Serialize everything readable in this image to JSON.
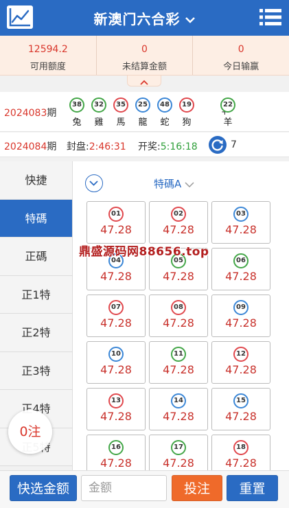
{
  "colors": {
    "primary": "#2a6bc3",
    "accent_red": "#d9362b",
    "bet_orange": "#ef6a2a",
    "balance_bg": "#fdeee4",
    "ball_red": "#e0474c",
    "ball_blue": "#3a86d6",
    "ball_green": "#43a647"
  },
  "header": {
    "title": "新澳门六合彩",
    "chart_icon": "line-chart-icon",
    "menu_icon": "menu-list-icon",
    "title_chevron": "chevron-down-icon"
  },
  "balance": [
    {
      "value": "12594.2",
      "label": "可用额度"
    },
    {
      "value": "0",
      "label": "未结算金额"
    },
    {
      "value": "0",
      "label": "今日输赢"
    }
  ],
  "last_draw": {
    "period": "2024083",
    "period_suffix": "期",
    "balls": [
      {
        "num": "38",
        "color": "green",
        "zodiac": "兔"
      },
      {
        "num": "32",
        "color": "green",
        "zodiac": "雞"
      },
      {
        "num": "35",
        "color": "red",
        "zodiac": "馬"
      },
      {
        "num": "25",
        "color": "blue",
        "zodiac": "龍"
      },
      {
        "num": "48",
        "color": "blue",
        "zodiac": "蛇"
      },
      {
        "num": "19",
        "color": "red",
        "zodiac": "狗"
      }
    ],
    "plus": "+",
    "special": {
      "num": "22",
      "color": "green",
      "zodiac": "羊"
    }
  },
  "next_draw": {
    "period": "2024084",
    "period_suffix": "期",
    "close_label": "封盘:",
    "close_time": "2:46:31",
    "open_label": "开奖:",
    "open_time": "5:16:18",
    "refresh_icon": "refresh-icon",
    "countdown": "7"
  },
  "sidebar": {
    "items": [
      {
        "label": "快捷",
        "active": false
      },
      {
        "label": "特碼",
        "active": true
      },
      {
        "label": "正碼",
        "active": false
      },
      {
        "label": "正1特",
        "active": false
      },
      {
        "label": "正2特",
        "active": false
      },
      {
        "label": "正3特",
        "active": false
      },
      {
        "label": "正4特",
        "active": false
      },
      {
        "label": "正5特",
        "active": false
      }
    ]
  },
  "main": {
    "play_type": "特碼A",
    "toggle_icon": "chevron-down-circle-icon",
    "numbers": [
      {
        "num": "01",
        "color": "red",
        "odds": "47.28"
      },
      {
        "num": "02",
        "color": "red",
        "odds": "47.28"
      },
      {
        "num": "03",
        "color": "blue",
        "odds": "47.28"
      },
      {
        "num": "04",
        "color": "blue",
        "odds": "47.28"
      },
      {
        "num": "05",
        "color": "green",
        "odds": "47.28"
      },
      {
        "num": "06",
        "color": "green",
        "odds": "47.28"
      },
      {
        "num": "07",
        "color": "red",
        "odds": "47.28"
      },
      {
        "num": "08",
        "color": "red",
        "odds": "47.28"
      },
      {
        "num": "09",
        "color": "blue",
        "odds": "47.28"
      },
      {
        "num": "10",
        "color": "blue",
        "odds": "47.28"
      },
      {
        "num": "11",
        "color": "green",
        "odds": "47.28"
      },
      {
        "num": "12",
        "color": "red",
        "odds": "47.28"
      },
      {
        "num": "13",
        "color": "red",
        "odds": "47.28"
      },
      {
        "num": "14",
        "color": "blue",
        "odds": "47.28"
      },
      {
        "num": "15",
        "color": "blue",
        "odds": "47.28"
      },
      {
        "num": "16",
        "color": "green",
        "odds": "47.28"
      },
      {
        "num": "17",
        "color": "green",
        "odds": "47.28"
      },
      {
        "num": "18",
        "color": "red",
        "odds": "47.28"
      }
    ]
  },
  "watermark": "鼎盛源码网88656.top",
  "bet_count": "0注",
  "bottom": {
    "quick_amount_label": "快选金额",
    "amount_placeholder": "金额",
    "bet_label": "投注",
    "reset_label": "重置"
  }
}
